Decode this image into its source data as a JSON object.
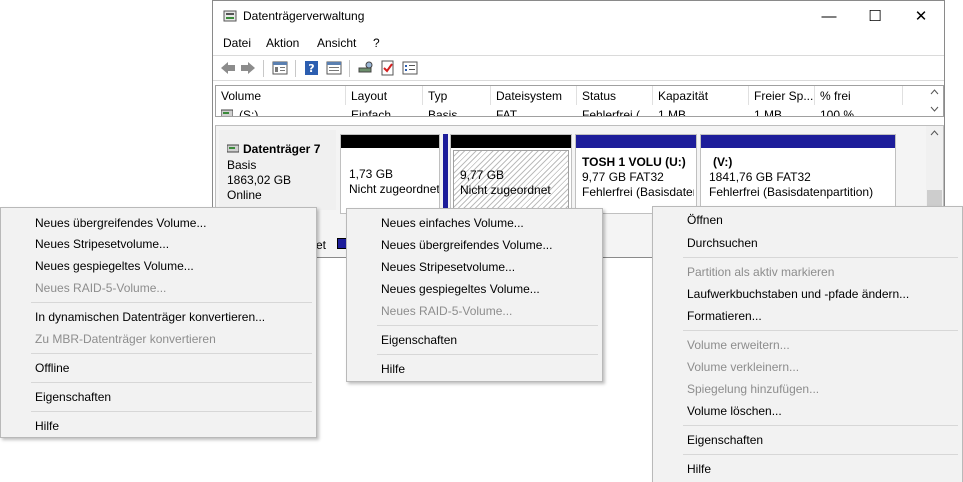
{
  "window": {
    "title": "Datenträgerverwaltung",
    "controls": {
      "minimize": "—",
      "maximize": "☐",
      "close": "✕"
    }
  },
  "menubar": [
    "Datei",
    "Aktion",
    "Ansicht",
    "?"
  ],
  "volume_table": {
    "headers": [
      "Volume",
      "Layout",
      "Typ",
      "Dateisystem",
      "Status",
      "Kapazität",
      "Freier Sp...",
      "% frei"
    ],
    "rows": [
      [
        "(S:)",
        "Einfach",
        "Basis",
        "FAT",
        "Fehlerfrei (",
        "1 MB",
        "1 MB",
        "100 %"
      ]
    ]
  },
  "disk": {
    "name": "Datenträger 7",
    "type": "Basis",
    "size": "1863,02 GB",
    "state": "Online",
    "partitions": [
      {
        "size": "1,73 GB",
        "status": "Nicht zugeordnet",
        "bar": "#000000"
      },
      {
        "size": "9,77 GB",
        "status": "Nicht zugeordnet",
        "bar": "#000000"
      },
      {
        "label": "TOSH 1 VOLU  (U:)",
        "size": "9,77 GB FAT32",
        "status": "Fehlerfrei (Basisdaten",
        "bar": "#1d1d9a"
      },
      {
        "label": "(V:)",
        "size": "1841,76 GB FAT32",
        "status": "Fehlerfrei (Basisdatenpartition)",
        "bar": "#1d1d9a"
      }
    ],
    "legend_fragment": "et"
  },
  "menu_disk": {
    "items": [
      "Neues übergreifendes Volume...",
      "Neues Stripesetvolume...",
      "Neues gespiegeltes Volume...",
      "Neues RAID-5-Volume...",
      "In dynamischen Datenträger konvertieren...",
      "Zu MBR-Datenträger konvertieren",
      "Offline",
      "Eigenschaften",
      "Hilfe"
    ]
  },
  "menu_unallocated": {
    "items": [
      "Neues einfaches Volume...",
      "Neues übergreifendes Volume...",
      "Neues Stripesetvolume...",
      "Neues gespiegeltes Volume...",
      "Neues RAID-5-Volume...",
      "Eigenschaften",
      "Hilfe"
    ]
  },
  "menu_volume": {
    "items": [
      "Öffnen",
      "Durchsuchen",
      "Partition als aktiv markieren",
      "Laufwerkbuchstaben und -pfade ändern...",
      "Formatieren...",
      "Volume erweitern...",
      "Volume verkleinern...",
      "Spiegelung hinzufügen...",
      "Volume löschen...",
      "Eigenschaften",
      "Hilfe"
    ]
  },
  "colors": {
    "primary_partition": "#1d1d9a",
    "unallocated": "#000000",
    "disabled_text": "#8d8d8d"
  }
}
